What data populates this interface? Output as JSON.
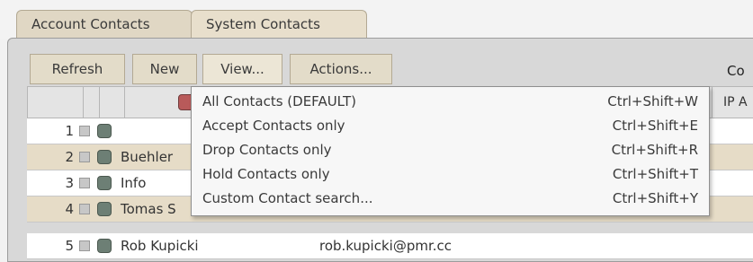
{
  "tabs": {
    "account": "Account Contacts",
    "system": "System Contacts"
  },
  "toolbar": {
    "refresh": "Refresh",
    "new": "New",
    "view": "View...",
    "actions": "Actions...",
    "right_label": "Co"
  },
  "table": {
    "ip_header": "IP A",
    "rows": [
      {
        "num": "1",
        "name": "",
        "email": ""
      },
      {
        "num": "2",
        "name": "Buehler",
        "email": ""
      },
      {
        "num": "3",
        "name": "Info",
        "email": ""
      },
      {
        "num": "4",
        "name": "Tomas S",
        "email": ""
      },
      {
        "num": "5",
        "name": "Rob Kupicki",
        "email": "rob.kupicki@pmr.cc"
      }
    ]
  },
  "view_menu": {
    "items": [
      {
        "label": "All Contacts (DEFAULT)",
        "shortcut": "Ctrl+Shift+W"
      },
      {
        "label": "Accept Contacts only",
        "shortcut": "Ctrl+Shift+E"
      },
      {
        "label": "Drop Contacts only",
        "shortcut": "Ctrl+Shift+R"
      },
      {
        "label": "Hold Contacts only",
        "shortcut": "Ctrl+Shift+T"
      },
      {
        "label": "Custom Contact search...",
        "shortcut": "Ctrl+Shift+Y"
      }
    ]
  },
  "colors": {
    "tab_bg": "#e0d7c4",
    "row_alt": "#e6dcc7",
    "status_header": "#b85a5a",
    "status_dot": "#6d7f75"
  }
}
